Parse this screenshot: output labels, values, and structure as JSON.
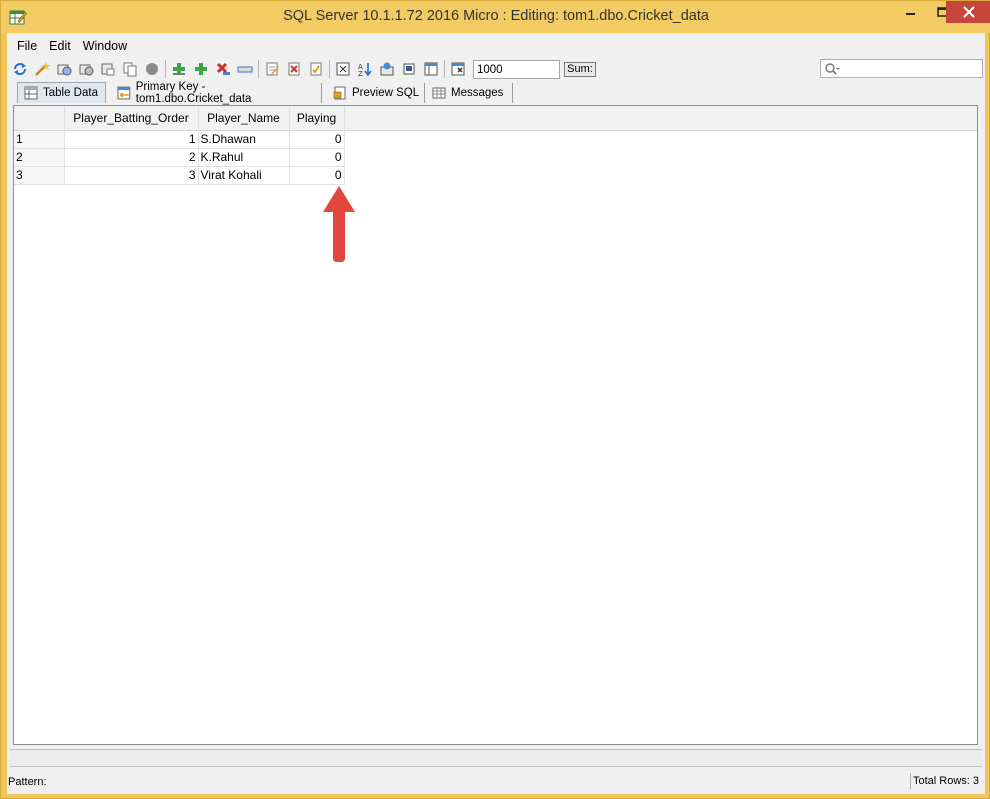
{
  "window": {
    "title": "SQL Server 10.1.1.72 2016 Micro : Editing: tom1.dbo.Cricket_data"
  },
  "menu": [
    "File",
    "Edit",
    "Window"
  ],
  "toolbar": {
    "limit_value": "1000",
    "sum_label": "Sum:"
  },
  "tabs": [
    {
      "label": "Table Data",
      "icon": "table-icon",
      "active": true
    },
    {
      "label": "Primary Key - tom1.dbo.Cricket_data",
      "icon": "key-table-icon",
      "active": false
    },
    {
      "label": "Preview SQL",
      "icon": "sql-document-icon",
      "active": false
    },
    {
      "label": "Messages",
      "icon": "grid-messages-icon",
      "active": false
    }
  ],
  "grid": {
    "columns": [
      "Player_Batting_Order",
      "Player_Name",
      "Playing"
    ],
    "rows": [
      {
        "num": "1",
        "cells": [
          "1",
          "S.Dhawan",
          "0"
        ]
      },
      {
        "num": "2",
        "cells": [
          "2",
          "K.Rahul",
          "0"
        ]
      },
      {
        "num": "3",
        "cells": [
          "3",
          "Virat Kohali",
          "0"
        ]
      }
    ]
  },
  "status": {
    "pattern_label": "Pattern:",
    "total_rows": "Total Rows: 3"
  },
  "colors": {
    "window_frame": "#f0c65a",
    "close_button": "#c7463c",
    "annotation_arrow": "#e2463f"
  }
}
